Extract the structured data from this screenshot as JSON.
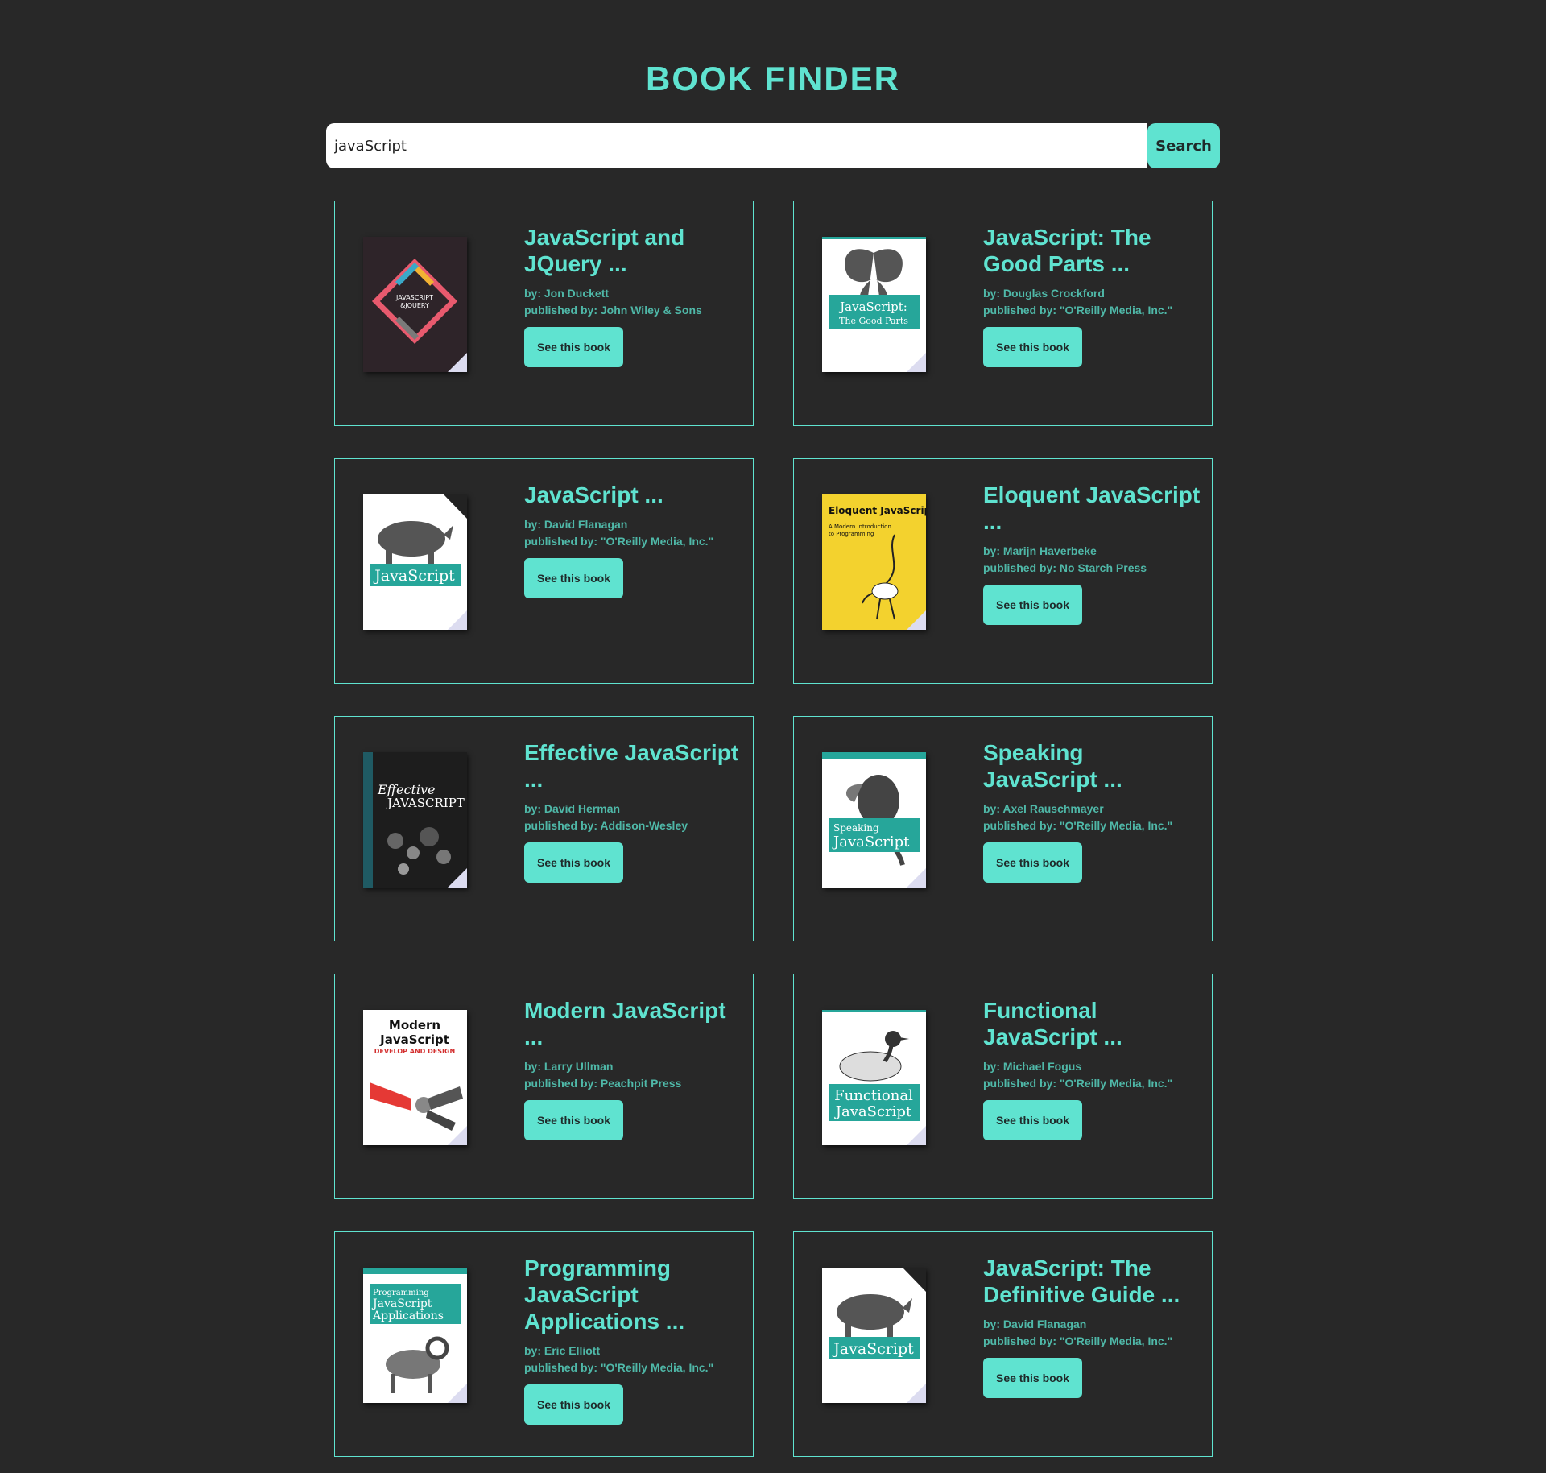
{
  "app": {
    "title": "BOOK FINDER"
  },
  "search": {
    "value": "javaScript",
    "button_label": "Search"
  },
  "colors": {
    "background": "#282828",
    "accent": "#5fe3d0",
    "meta_text": "#4fb8a8"
  },
  "books": [
    {
      "title": "JavaScript and JQuery ...",
      "author": "by: Jon Duckett",
      "publisher": "published by: John Wiley & Sons",
      "button_label": "See this book",
      "cover_icon": "js-jquery-cover"
    },
    {
      "title": "JavaScript: The Good Parts ...",
      "author": "by: Douglas Crockford",
      "publisher": "published by: \"O'Reilly Media, Inc.\"",
      "button_label": "See this book",
      "cover_icon": "butterfly-cover"
    },
    {
      "title": "JavaScript ...",
      "author": "by: David Flanagan",
      "publisher": "published by: \"O'Reilly Media, Inc.\"",
      "button_label": "See this book",
      "cover_icon": "rhino-cover"
    },
    {
      "title": "Eloquent JavaScript ...",
      "author": "by: Marijn Haverbeke",
      "publisher": "published by: No Starch Press",
      "button_label": "See this book",
      "cover_icon": "eloquent-cover"
    },
    {
      "title": "Effective JavaScript ...",
      "author": "by: David Herman",
      "publisher": "published by: Addison-Wesley",
      "button_label": "See this book",
      "cover_icon": "effective-cover"
    },
    {
      "title": "Speaking JavaScript ...",
      "author": "by: Axel Rauschmayer",
      "publisher": "published by: \"O'Reilly Media, Inc.\"",
      "button_label": "See this book",
      "cover_icon": "hornbill-cover"
    },
    {
      "title": "Modern JavaScript ...",
      "author": "by: Larry Ullman",
      "publisher": "published by: Peachpit Press",
      "button_label": "See this book",
      "cover_icon": "pliers-cover"
    },
    {
      "title": "Functional JavaScript ...",
      "author": "by: Michael Fogus",
      "publisher": "published by: \"O'Reilly Media, Inc.\"",
      "button_label": "See this book",
      "cover_icon": "bird-cover"
    },
    {
      "title": "Programming JavaScript Applications ...",
      "author": "by: Eric Elliott",
      "publisher": "published by: \"O'Reilly Media, Inc.\"",
      "button_label": "See this book",
      "cover_icon": "ram-cover"
    },
    {
      "title": "JavaScript: The Definitive Guide ...",
      "author": "by: David Flanagan",
      "publisher": "published by: \"O'Reilly Media, Inc.\"",
      "button_label": "See this book",
      "cover_icon": "rhino-cover"
    }
  ]
}
